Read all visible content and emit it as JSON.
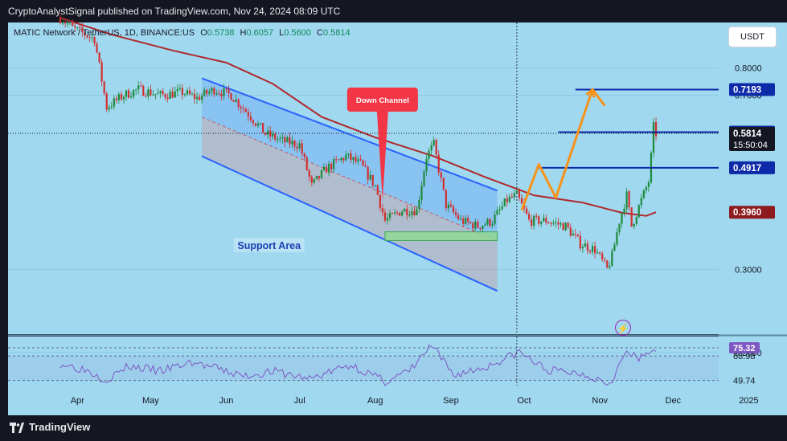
{
  "header": {
    "published": "CryptoAnalystSignal published on TradingView.com, Nov 24, 2024 08:09 UTC"
  },
  "legend": {
    "symbol": "MATIC Network / TetherUS, 1D, BINANCE:US",
    "open_label": "O",
    "open": "0.5738",
    "high_label": "H",
    "high": "0.6057",
    "low_label": "L",
    "low": "0.5600",
    "close_label": "C",
    "close": "0.5814"
  },
  "currency_button": "USDT",
  "footer": {
    "brand": "TradingView"
  },
  "colors": {
    "background": "#9fd8ef",
    "up_candle": "#1e8a3a",
    "down_candle": "#d32f2f",
    "moving_average": "#b0282c",
    "channel": "#2962ff",
    "projection": "#f7931a",
    "level_line": "#0d2aa8",
    "rsi": "#7e57c2",
    "price_tag_dark": "#131722"
  },
  "chart_data": {
    "type": "candlestick",
    "pair": "MATIC/USDT",
    "timeframe": "1D",
    "y_scale": "log",
    "ylim": [
      0.18,
      0.98
    ],
    "price_ticks": [
      0.8,
      0.7,
      0.3,
      0.2
    ],
    "x_ticks": [
      "Apr",
      "May",
      "Jun",
      "Jul",
      "Aug",
      "Sep",
      "Oct",
      "Nov",
      "Dec",
      "2025"
    ],
    "series": [
      {
        "name": "price",
        "points": [
          {
            "date": "2024-03-25",
            "close": 1.02
          },
          {
            "date": "2024-03-30",
            "close": 0.97
          },
          {
            "date": "2024-04-08",
            "close": 0.92
          },
          {
            "date": "2024-04-13",
            "close": 0.66
          },
          {
            "date": "2024-04-20",
            "close": 0.7
          },
          {
            "date": "2024-04-26",
            "close": 0.72
          },
          {
            "date": "2024-05-05",
            "close": 0.7
          },
          {
            "date": "2024-05-14",
            "close": 0.71
          },
          {
            "date": "2024-05-20",
            "close": 0.69
          },
          {
            "date": "2024-05-27",
            "close": 0.72
          },
          {
            "date": "2024-06-03",
            "close": 0.7
          },
          {
            "date": "2024-06-10",
            "close": 0.64
          },
          {
            "date": "2024-06-17",
            "close": 0.58
          },
          {
            "date": "2024-06-24",
            "close": 0.56
          },
          {
            "date": "2024-07-01",
            "close": 0.55
          },
          {
            "date": "2024-07-06",
            "close": 0.45
          },
          {
            "date": "2024-07-12",
            "close": 0.49
          },
          {
            "date": "2024-07-20",
            "close": 0.52
          },
          {
            "date": "2024-07-26",
            "close": 0.5
          },
          {
            "date": "2024-08-01",
            "close": 0.45
          },
          {
            "date": "2024-08-05",
            "close": 0.38
          },
          {
            "date": "2024-08-12",
            "close": 0.4
          },
          {
            "date": "2024-08-18",
            "close": 0.4
          },
          {
            "date": "2024-08-22",
            "close": 0.52
          },
          {
            "date": "2024-08-25",
            "close": 0.55
          },
          {
            "date": "2024-08-30",
            "close": 0.41
          },
          {
            "date": "2024-09-05",
            "close": 0.38
          },
          {
            "date": "2024-09-12",
            "close": 0.37
          },
          {
            "date": "2024-09-18",
            "close": 0.38
          },
          {
            "date": "2024-09-24",
            "close": 0.42
          },
          {
            "date": "2024-09-28",
            "close": 0.43
          },
          {
            "date": "2024-10-03",
            "close": 0.38
          },
          {
            "date": "2024-10-10",
            "close": 0.38
          },
          {
            "date": "2024-10-18",
            "close": 0.37
          },
          {
            "date": "2024-10-24",
            "close": 0.34
          },
          {
            "date": "2024-10-30",
            "close": 0.33
          },
          {
            "date": "2024-11-04",
            "close": 0.3
          },
          {
            "date": "2024-11-06",
            "close": 0.32
          },
          {
            "date": "2024-11-09",
            "close": 0.38
          },
          {
            "date": "2024-11-12",
            "close": 0.43
          },
          {
            "date": "2024-11-14",
            "close": 0.37
          },
          {
            "date": "2024-11-18",
            "close": 0.42
          },
          {
            "date": "2024-11-21",
            "close": 0.46
          },
          {
            "date": "2024-11-22",
            "close": 0.52
          },
          {
            "date": "2024-11-23",
            "close": 0.6
          },
          {
            "date": "2024-11-24",
            "close": 0.5814
          }
        ]
      },
      {
        "name": "moving_average",
        "points": [
          {
            "date": "2024-03-25",
            "value": 1.02
          },
          {
            "date": "2024-04-15",
            "value": 0.94
          },
          {
            "date": "2024-05-10",
            "value": 0.87
          },
          {
            "date": "2024-06-01",
            "value": 0.82
          },
          {
            "date": "2024-06-20",
            "value": 0.74
          },
          {
            "date": "2024-07-10",
            "value": 0.63
          },
          {
            "date": "2024-08-01",
            "value": 0.57
          },
          {
            "date": "2024-08-25",
            "value": 0.52
          },
          {
            "date": "2024-09-15",
            "value": 0.47
          },
          {
            "date": "2024-10-05",
            "value": 0.43
          },
          {
            "date": "2024-10-25",
            "value": 0.415
          },
          {
            "date": "2024-11-10",
            "value": 0.395
          },
          {
            "date": "2024-11-20",
            "value": 0.389
          },
          {
            "date": "2024-11-24",
            "value": 0.396
          }
        ]
      },
      {
        "name": "projection",
        "points": [
          {
            "date": "2024-09-30",
            "value": 0.4
          },
          {
            "date": "2024-10-07",
            "value": 0.5
          },
          {
            "date": "2024-10-14",
            "value": 0.425
          },
          {
            "date": "2024-10-29",
            "value": 0.72
          },
          {
            "date": "2024-11-03",
            "value": 0.665
          }
        ]
      }
    ],
    "channel": {
      "upper": [
        {
          "date": "2024-05-22",
          "value": 0.76
        },
        {
          "date": "2024-09-20",
          "value": 0.44
        }
      ],
      "lower": [
        {
          "date": "2024-05-22",
          "value": 0.52
        },
        {
          "date": "2024-09-20",
          "value": 0.27
        }
      ]
    },
    "support_area": {
      "from": "2024-08-05",
      "to": "2024-09-20",
      "low": 0.345,
      "high": 0.36
    },
    "levels": [
      {
        "value": 0.7193,
        "label": "0.7193",
        "from": "2024-10-22"
      },
      {
        "value": 0.5847,
        "label": "0.5847",
        "from": "2024-10-15"
      },
      {
        "value": 0.4917,
        "label": "0.4917",
        "from": "2024-10-07"
      }
    ],
    "price_tags": [
      {
        "value": 0.5814,
        "label": "0.5814",
        "countdown": "15:50:04",
        "kind": "current"
      },
      {
        "value": 0.396,
        "label": "0.3960",
        "kind": "ma"
      }
    ],
    "annotations": [
      {
        "text": "Down Channel",
        "kind": "callout",
        "date": "2024-08-04",
        "price": 0.42
      },
      {
        "text": "Support Area",
        "kind": "label",
        "date": "2024-07-04",
        "price": 0.335
      }
    ],
    "rsi": {
      "ylim": [
        45,
        80
      ],
      "levels": [
        {
          "value": 75.32,
          "label": "75.32"
        },
        {
          "value": 68.98,
          "label": "68.98"
        },
        {
          "value": 49.74,
          "label": "49.74"
        }
      ],
      "points": [
        {
          "date": "2024-03-25",
          "value": 63
        },
        {
          "date": "2024-04-05",
          "value": 58
        },
        {
          "date": "2024-04-13",
          "value": 50
        },
        {
          "date": "2024-04-22",
          "value": 61
        },
        {
          "date": "2024-05-05",
          "value": 57
        },
        {
          "date": "2024-05-18",
          "value": 64
        },
        {
          "date": "2024-05-28",
          "value": 59
        },
        {
          "date": "2024-06-08",
          "value": 53
        },
        {
          "date": "2024-06-20",
          "value": 57
        },
        {
          "date": "2024-07-05",
          "value": 51
        },
        {
          "date": "2024-07-22",
          "value": 62
        },
        {
          "date": "2024-08-05",
          "value": 49
        },
        {
          "date": "2024-08-15",
          "value": 57
        },
        {
          "date": "2024-08-24",
          "value": 77
        },
        {
          "date": "2024-09-02",
          "value": 54
        },
        {
          "date": "2024-09-15",
          "value": 60
        },
        {
          "date": "2024-09-29",
          "value": 72
        },
        {
          "date": "2024-10-10",
          "value": 58
        },
        {
          "date": "2024-10-25",
          "value": 55
        },
        {
          "date": "2024-11-05",
          "value": 48
        },
        {
          "date": "2024-11-12",
          "value": 72
        },
        {
          "date": "2024-11-17",
          "value": 66
        },
        {
          "date": "2024-11-22",
          "value": 73
        },
        {
          "date": "2024-11-24",
          "value": 75.32
        }
      ]
    }
  }
}
